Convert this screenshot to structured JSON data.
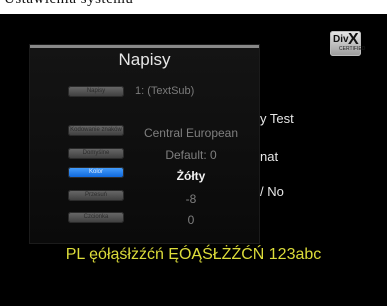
{
  "top_band_text": "Ustawienia systemu",
  "menu_title": "Napisy",
  "subtitle_track": "1: (TextSub)",
  "menu_buttons": [
    {
      "label": "Napisy",
      "selected": false
    },
    {
      "label": "Kodowanie znaków",
      "selected": false
    },
    {
      "label": "Domyślne",
      "selected": false
    },
    {
      "label": "Kolor",
      "selected": true
    },
    {
      "label": "Przesuń",
      "selected": false
    },
    {
      "label": "Czcionka",
      "selected": false
    }
  ],
  "values": [
    {
      "text": "Central European",
      "selected": false
    },
    {
      "text": "Default: 0",
      "selected": false
    },
    {
      "text": "Żółty",
      "selected": true
    },
    {
      "text": "-8",
      "selected": false
    },
    {
      "text": "0",
      "selected": false
    }
  ],
  "background_text": {
    "line1": "y Test",
    "line2": "nat",
    "line3": "/ No"
  },
  "sample_text": "PL ęółąśłżźćń ĘÓĄŚŁŻŹĆŃ 123abc",
  "logo": {
    "brand": "DivX",
    "tag": "CERTIFIED"
  },
  "colors": {
    "accent": "#1a7cf0",
    "sample_text": "#dcdc3a",
    "background": "#000000"
  }
}
